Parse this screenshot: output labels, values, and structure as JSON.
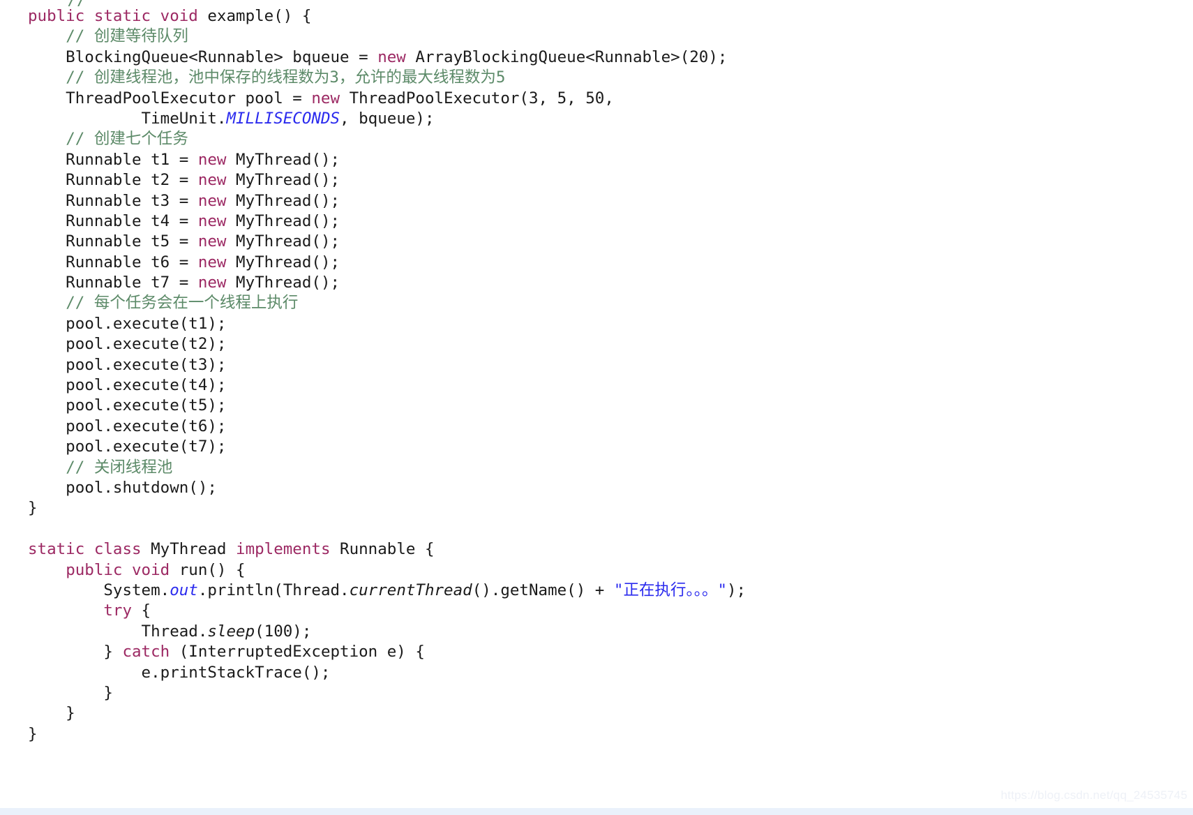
{
  "document": {
    "kind": "code-snippet",
    "language": "Java",
    "watermark": "https://blog.csdn.net/qq_24535745"
  },
  "colors": {
    "background": "#ffffff",
    "text": "#1a1a1a",
    "keyword": "#9c2963",
    "comment": "#5c8a68",
    "string": "#2b2bee",
    "constant": "#2b2bee",
    "bottom_bar": "#eaf1fb",
    "watermark": "#eef1f7"
  },
  "lines": [
    {
      "id": "l00",
      "clipped": true,
      "tokens": [
        {
          "t": "    ",
          "c": "plain"
        },
        {
          "t": "//",
          "c": "com"
        }
      ]
    },
    {
      "id": "l01",
      "tokens": [
        {
          "t": "public static void",
          "c": "kw"
        },
        {
          "t": " example() {",
          "c": "plain"
        }
      ]
    },
    {
      "id": "l02",
      "tokens": [
        {
          "t": "    ",
          "c": "plain"
        },
        {
          "t": "// 创建等待队列",
          "c": "com"
        }
      ]
    },
    {
      "id": "l03",
      "tokens": [
        {
          "t": "    BlockingQueue<Runnable> bqueue = ",
          "c": "plain"
        },
        {
          "t": "new",
          "c": "kw"
        },
        {
          "t": " ArrayBlockingQueue<Runnable>(20);",
          "c": "plain"
        }
      ]
    },
    {
      "id": "l04",
      "tokens": [
        {
          "t": "    ",
          "c": "plain"
        },
        {
          "t": "// 创建线程池，池中保存的线程数为3，允许的最大线程数为5",
          "c": "com"
        }
      ]
    },
    {
      "id": "l05",
      "tokens": [
        {
          "t": "    ThreadPoolExecutor pool = ",
          "c": "plain"
        },
        {
          "t": "new",
          "c": "kw"
        },
        {
          "t": " ThreadPoolExecutor(3, 5, 50,",
          "c": "plain"
        }
      ]
    },
    {
      "id": "l06",
      "tokens": [
        {
          "t": "            TimeUnit.",
          "c": "plain"
        },
        {
          "t": "MILLISECONDS",
          "c": "const"
        },
        {
          "t": ", bqueue);",
          "c": "plain"
        }
      ]
    },
    {
      "id": "l07",
      "tokens": [
        {
          "t": "    ",
          "c": "plain"
        },
        {
          "t": "// 创建七个任务",
          "c": "com"
        }
      ]
    },
    {
      "id": "l08",
      "tokens": [
        {
          "t": "    Runnable t1 = ",
          "c": "plain"
        },
        {
          "t": "new",
          "c": "kw"
        },
        {
          "t": " MyThread();",
          "c": "plain"
        }
      ]
    },
    {
      "id": "l09",
      "tokens": [
        {
          "t": "    Runnable t2 = ",
          "c": "plain"
        },
        {
          "t": "new",
          "c": "kw"
        },
        {
          "t": " MyThread();",
          "c": "plain"
        }
      ]
    },
    {
      "id": "l10",
      "tokens": [
        {
          "t": "    Runnable t3 = ",
          "c": "plain"
        },
        {
          "t": "new",
          "c": "kw"
        },
        {
          "t": " MyThread();",
          "c": "plain"
        }
      ]
    },
    {
      "id": "l11",
      "tokens": [
        {
          "t": "    Runnable t4 = ",
          "c": "plain"
        },
        {
          "t": "new",
          "c": "kw"
        },
        {
          "t": " MyThread();",
          "c": "plain"
        }
      ]
    },
    {
      "id": "l12",
      "tokens": [
        {
          "t": "    Runnable t5 = ",
          "c": "plain"
        },
        {
          "t": "new",
          "c": "kw"
        },
        {
          "t": " MyThread();",
          "c": "plain"
        }
      ]
    },
    {
      "id": "l13",
      "tokens": [
        {
          "t": "    Runnable t6 = ",
          "c": "plain"
        },
        {
          "t": "new",
          "c": "kw"
        },
        {
          "t": " MyThread();",
          "c": "plain"
        }
      ]
    },
    {
      "id": "l14",
      "tokens": [
        {
          "t": "    Runnable t7 = ",
          "c": "plain"
        },
        {
          "t": "new",
          "c": "kw"
        },
        {
          "t": " MyThread();",
          "c": "plain"
        }
      ]
    },
    {
      "id": "l15",
      "tokens": [
        {
          "t": "    ",
          "c": "plain"
        },
        {
          "t": "// 每个任务会在一个线程上执行",
          "c": "com"
        }
      ]
    },
    {
      "id": "l16",
      "tokens": [
        {
          "t": "    pool.execute(t1);",
          "c": "plain"
        }
      ]
    },
    {
      "id": "l17",
      "tokens": [
        {
          "t": "    pool.execute(t2);",
          "c": "plain"
        }
      ]
    },
    {
      "id": "l18",
      "tokens": [
        {
          "t": "    pool.execute(t3);",
          "c": "plain"
        }
      ]
    },
    {
      "id": "l19",
      "tokens": [
        {
          "t": "    pool.execute(t4);",
          "c": "plain"
        }
      ]
    },
    {
      "id": "l20",
      "tokens": [
        {
          "t": "    pool.execute(t5);",
          "c": "plain"
        }
      ]
    },
    {
      "id": "l21",
      "tokens": [
        {
          "t": "    pool.execute(t6);",
          "c": "plain"
        }
      ]
    },
    {
      "id": "l22",
      "tokens": [
        {
          "t": "    pool.execute(t7);",
          "c": "plain"
        }
      ]
    },
    {
      "id": "l23",
      "tokens": [
        {
          "t": "    ",
          "c": "plain"
        },
        {
          "t": "// 关闭线程池",
          "c": "com"
        }
      ]
    },
    {
      "id": "l24",
      "tokens": [
        {
          "t": "    pool.shutdown();",
          "c": "plain"
        }
      ]
    },
    {
      "id": "l25",
      "tokens": [
        {
          "t": "}",
          "c": "plain"
        }
      ]
    },
    {
      "id": "l26",
      "tokens": [
        {
          "t": " ",
          "c": "plain"
        }
      ]
    },
    {
      "id": "l27",
      "tokens": [
        {
          "t": "static class",
          "c": "kw"
        },
        {
          "t": " MyThread ",
          "c": "plain"
        },
        {
          "t": "implements",
          "c": "kw"
        },
        {
          "t": " Runnable {",
          "c": "plain"
        }
      ]
    },
    {
      "id": "l28",
      "tokens": [
        {
          "t": "    ",
          "c": "plain"
        },
        {
          "t": "public void",
          "c": "kw"
        },
        {
          "t": " run() {",
          "c": "plain"
        }
      ]
    },
    {
      "id": "l29",
      "tokens": [
        {
          "t": "        System.",
          "c": "plain"
        },
        {
          "t": "out",
          "c": "static"
        },
        {
          "t": ".println(Thread.",
          "c": "plain"
        },
        {
          "t": "currentThread",
          "c": "ital"
        },
        {
          "t": "().getName() + ",
          "c": "plain"
        },
        {
          "t": "\"正在执行。。。\"",
          "c": "str"
        },
        {
          "t": ");",
          "c": "plain"
        }
      ]
    },
    {
      "id": "l30",
      "tokens": [
        {
          "t": "        ",
          "c": "plain"
        },
        {
          "t": "try",
          "c": "kw"
        },
        {
          "t": " {",
          "c": "plain"
        }
      ]
    },
    {
      "id": "l31",
      "tokens": [
        {
          "t": "            Thread.",
          "c": "plain"
        },
        {
          "t": "sleep",
          "c": "ital"
        },
        {
          "t": "(100);",
          "c": "plain"
        }
      ]
    },
    {
      "id": "l32",
      "tokens": [
        {
          "t": "        } ",
          "c": "plain"
        },
        {
          "t": "catch",
          "c": "kw"
        },
        {
          "t": " (InterruptedException e) {",
          "c": "plain"
        }
      ]
    },
    {
      "id": "l33",
      "tokens": [
        {
          "t": "            e.printStackTrace();",
          "c": "plain"
        }
      ]
    },
    {
      "id": "l34",
      "tokens": [
        {
          "t": "        }",
          "c": "plain"
        }
      ]
    },
    {
      "id": "l35",
      "tokens": [
        {
          "t": "    }",
          "c": "plain"
        }
      ]
    },
    {
      "id": "l36",
      "tokens": [
        {
          "t": "}",
          "c": "plain"
        }
      ]
    }
  ]
}
